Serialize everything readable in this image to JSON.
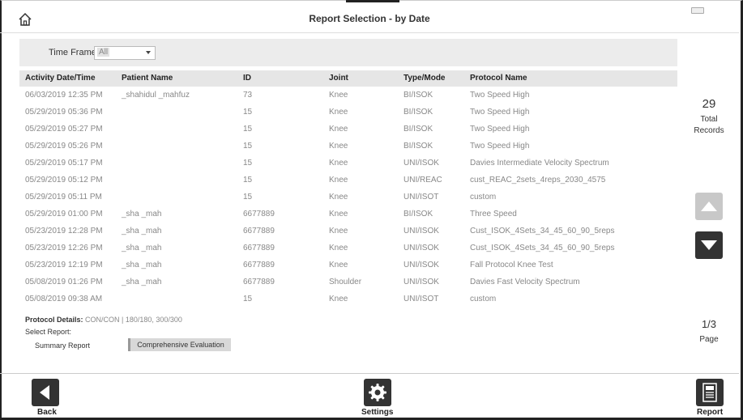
{
  "header": {
    "title": "Report Selection - by Date",
    "home_icon": "home-icon"
  },
  "filter": {
    "label": "Time Frame:",
    "value": "All"
  },
  "table": {
    "columns": [
      "Activity Date/Time",
      "Patient Name",
      "ID",
      "Joint",
      "Type/Mode",
      "Protocol Name"
    ],
    "rows": [
      [
        "06/03/2019 12:35 PM",
        "_shahidul _mahfuz",
        "73",
        "Knee",
        "BI/ISOK",
        "Two Speed High"
      ],
      [
        "05/29/2019 05:36 PM",
        "",
        "15",
        "Knee",
        "BI/ISOK",
        "Two Speed High"
      ],
      [
        "05/29/2019 05:27 PM",
        "",
        "15",
        "Knee",
        "BI/ISOK",
        "Two Speed High"
      ],
      [
        "05/29/2019 05:26 PM",
        "",
        "15",
        "Knee",
        "BI/ISOK",
        "Two Speed High"
      ],
      [
        "05/29/2019 05:17 PM",
        "",
        "15",
        "Knee",
        "UNI/ISOK",
        "Davies Intermediate Velocity Spectrum"
      ],
      [
        "05/29/2019 05:12 PM",
        "",
        "15",
        "Knee",
        "UNI/REAC",
        "cust_REAC_2sets_4reps_2030_4575"
      ],
      [
        "05/29/2019 05:11 PM",
        "",
        "15",
        "Knee",
        "UNI/ISOT",
        "custom"
      ],
      [
        "05/29/2019 01:00 PM",
        "_sha _mah",
        "6677889",
        "Knee",
        "BI/ISOK",
        "Three Speed"
      ],
      [
        "05/23/2019 12:28 PM",
        "_sha _mah",
        "6677889",
        "Knee",
        "UNI/ISOK",
        "Cust_ISOK_4Sets_34_45_60_90_5reps"
      ],
      [
        "05/23/2019 12:26 PM",
        "_sha _mah",
        "6677889",
        "Knee",
        "UNI/ISOK",
        "Cust_ISOK_4Sets_34_45_60_90_5reps"
      ],
      [
        "05/23/2019 12:19 PM",
        "_sha _mah",
        "6677889",
        "Knee",
        "UNI/ISOK",
        "Fall Protocol Knee Test"
      ],
      [
        "05/08/2019 01:26 PM",
        "_sha _mah",
        "6677889",
        "Shoulder",
        "UNI/ISOK",
        "Davies Fast Velocity Spectrum"
      ],
      [
        "05/08/2019 09:38 AM",
        "",
        "15",
        "Knee",
        "UNI/ISOT",
        "custom"
      ]
    ]
  },
  "details": {
    "protocol_label": "Protocol Details:",
    "protocol_value": "CON/CON | 180/180, 300/300",
    "select_report_label": "Select Report:",
    "summary_report": "Summary Report",
    "comprehensive_evaluation": "Comprehensive Evaluation"
  },
  "sidebar": {
    "total_count": "29",
    "total_label_1": "Total",
    "total_label_2": "Records",
    "page": "1/3",
    "page_label": "Page"
  },
  "footer": {
    "back": "Back",
    "settings": "Settings",
    "report": "Report"
  },
  "icons": {
    "home": "home-icon",
    "up": "triangle-up-icon",
    "down": "triangle-down-icon",
    "back": "triangle-left-icon",
    "settings": "gear-icon",
    "report": "document-icon"
  },
  "colors": {
    "dark_button": "#333333",
    "disabled_button": "#c8c8c8",
    "header_bg": "#e6e6e6"
  }
}
